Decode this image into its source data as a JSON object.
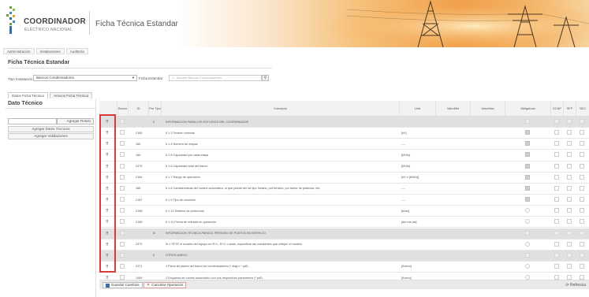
{
  "header": {
    "logo_main": "COORDINADOR",
    "logo_sub": "ELÉCTRICO NACIONAL",
    "app_title": "Ficha Técnica Estandar"
  },
  "nav": [
    "Administración",
    "Instalaciones",
    "Auditoría"
  ],
  "page_title": "Ficha Técnica Estandar",
  "filter": {
    "tipo_label": "Tipo Instalación",
    "tipo_value": "Bancos Condensadores",
    "ficha_label": "Ficha Estandar",
    "ficha_placeholder": "1 - Informe Bancos Condensadores"
  },
  "tabs": [
    "Datos Ficha Técnica",
    "Anexos Ficha Técnica"
  ],
  "left": {
    "title": "Dato Técnico",
    "agregar_rotulo": "Agregar Rotulo",
    "agregar_datos": "Agregar Datos Técnicos",
    "agregar_validaciones": "Agregar Validaciones"
  },
  "table": {
    "headers": [
      "Borrar",
      "ID",
      "Pre Tipo",
      "Concepto",
      "Unit",
      "ValorMin",
      "ValorMax",
      "Obligatorio",
      "SCAP",
      "SFP",
      "SEC"
    ],
    "rows": [
      {
        "type": "section",
        "id": "",
        "pre": "II",
        "concepto": "INFORMACION PARA LOS ESTUDIOS DEL COORDINADOR",
        "unit": "",
        "obl": ""
      },
      {
        "type": "data",
        "id": "2165",
        "pre": "",
        "concepto": "II.1.3 Tensión nominal",
        "unit": "[kV]",
        "obl": "gray"
      },
      {
        "type": "data",
        "id": "166",
        "pre": "",
        "concepto": "II.1.4 Número de etapas",
        "unit": "----",
        "obl": "gray"
      },
      {
        "type": "data",
        "id": "166",
        "pre": "",
        "concepto": "II.1.5 Capacidad por cada etapa",
        "unit": "[MVAr]",
        "obl": "gray"
      },
      {
        "type": "data",
        "id": "2479",
        "pre": "",
        "concepto": "II.1.6 Capacidad total del banco",
        "unit": "[MVAr]",
        "obl": "gray"
      },
      {
        "type": "data",
        "id": "2184",
        "pre": "",
        "concepto": "II.1.7 Rango de operación",
        "unit": "[kV o [MVAr]]",
        "obl": "gray"
      },
      {
        "type": "data",
        "id": "168",
        "pre": "",
        "concepto": "II.1.8 Características del control automático, si que puede ser de tipo horario, por tensión, por factor de potencia, etc.",
        "unit": "----",
        "obl": "gray"
      },
      {
        "type": "data",
        "id": "2187",
        "pre": "",
        "concepto": "II.1.9 Tipo de conexión",
        "unit": "----",
        "obl": "gray"
      },
      {
        "type": "data",
        "id": "2188",
        "pre": "",
        "concepto": "II.1.10 Sistema de protección",
        "unit": "[texto]",
        "obl": "circle"
      },
      {
        "type": "data",
        "id": "2189",
        "pre": "",
        "concepto": "II.1.11 Fecha de entrada en operación",
        "unit": "[dd-mm-aa]",
        "obl": "circle"
      },
      {
        "type": "section",
        "id": "",
        "pre": "III",
        "concepto": "INFORMACION TÉCNICA PARA EL PERIODO DE PUESTA EN SERVICIO",
        "unit": "",
        "obl": ""
      },
      {
        "type": "data",
        "id": "2370",
        "pre": "",
        "concepto": "III.1 SFTE el modelo del equipo en R+L, R+C o stato, especificar las resultantes que reflejen el modelo",
        "unit": "",
        "obl": "circle"
      },
      {
        "type": "section",
        "id": "",
        "pre": "II",
        "concepto": "OTROS ANEXO",
        "unit": "",
        "obl": ""
      },
      {
        "type": "data",
        "id": "2371",
        "pre": "",
        "concepto": "1 Plano de planta del banco de condensadores (* dwg o * pdf)",
        "unit": "[Anexo]",
        "obl": "circle"
      },
      {
        "type": "data",
        "id": "1489",
        "pre": "",
        "concepto": "2 Esquema de control automático con sus respectivos parámetros (* pdf)",
        "unit": "[Anexo]",
        "obl": "circle"
      }
    ]
  },
  "footer": {
    "save_label": "Guardar Cambios",
    "cancel_label": "Cancelar Operación",
    "refresh_label": "Refresca"
  }
}
